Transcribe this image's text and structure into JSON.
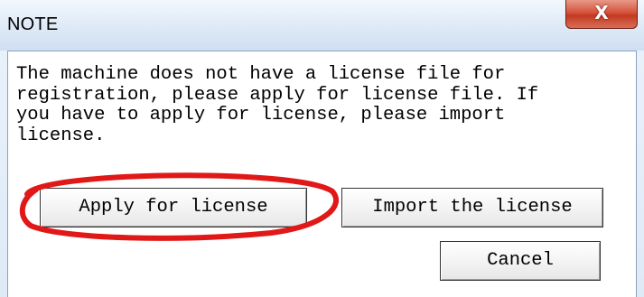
{
  "window": {
    "title": "NOTE",
    "close_label": "X"
  },
  "message": "The machine does not have a license file for\nregistration, please apply for license file. If\nyou have to apply for license, please import\nlicense.",
  "buttons": {
    "apply": "Apply for license",
    "import": "Import the license",
    "cancel": "Cancel"
  },
  "annotation": {
    "color": "#e11818",
    "target": "apply-for-license-button"
  }
}
